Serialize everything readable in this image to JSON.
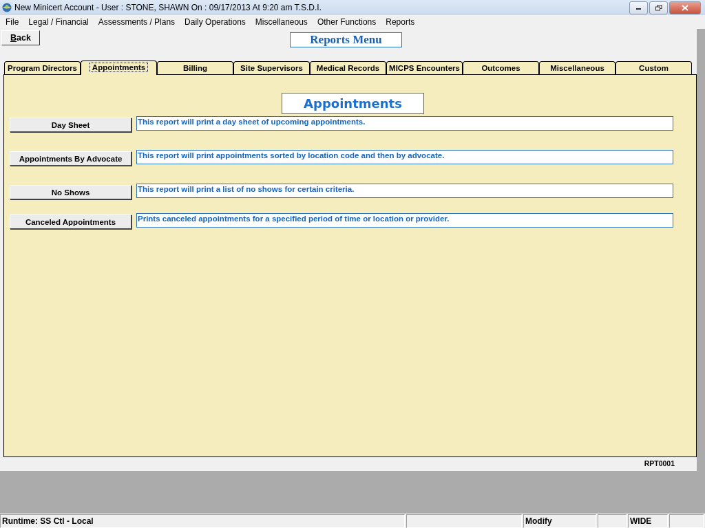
{
  "window": {
    "title": "New Minicert Account  - User : STONE, SHAWN On : 09/17/2013 At  9:20 am  T.S.D.I."
  },
  "menu": [
    "File",
    "Legal / Financial",
    "Assessments / Plans",
    "Daily Operations",
    "Miscellaneous",
    "Other Functions",
    "Reports"
  ],
  "back_button": "Back",
  "heading": "Reports Menu",
  "tabs": [
    {
      "label": "Program Directors",
      "selected": false
    },
    {
      "label": "Appointments",
      "selected": true
    },
    {
      "label": "Billing",
      "selected": false
    },
    {
      "label": "Site Supervisors",
      "selected": false
    },
    {
      "label": "Medical Records",
      "selected": false
    },
    {
      "label": "MICPS Encounters",
      "selected": false
    },
    {
      "label": "Outcomes",
      "selected": false
    },
    {
      "label": "Miscellaneous",
      "selected": false
    },
    {
      "label": "Custom",
      "selected": false
    }
  ],
  "panel_title": "Appointments",
  "reports": [
    {
      "button": "Day Sheet",
      "description": "This report will print a day sheet of upcoming appointments."
    },
    {
      "button": "Appointments By Advocate",
      "description": "This report will print appointments sorted by location code and then by advocate."
    },
    {
      "button": "No Shows",
      "description": "This report will print a list of no shows for certain criteria."
    },
    {
      "button": "Canceled Appointments",
      "description": "Prints canceled appointments for a specified period of time or location or provider."
    }
  ],
  "form_code": "RPT0001",
  "status_bar": [
    {
      "kind": "text",
      "text": "Runtime: SS Ctl - Local"
    },
    {
      "kind": "blank"
    },
    {
      "kind": "text",
      "text": "Modify"
    },
    {
      "kind": "blank"
    },
    {
      "kind": "text",
      "text": "WIDE"
    },
    {
      "kind": "blank"
    }
  ]
}
